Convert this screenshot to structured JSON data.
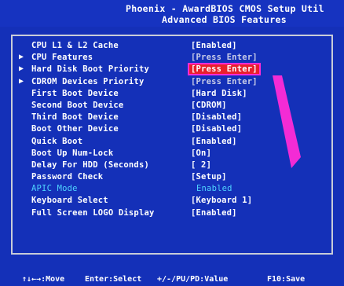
{
  "header": {
    "line1": "Phoenix - AwardBIOS CMOS Setup Util",
    "line2": "Advanced BIOS Features"
  },
  "rows": [
    {
      "arrow": "",
      "label": "CPU L1 & L2 Cache",
      "value": "[Enabled]"
    },
    {
      "arrow": "▶",
      "label": "CPU Features",
      "value": "[Press Enter]"
    },
    {
      "arrow": "▶",
      "label": "Hard Disk Boot Priority",
      "value": "[Press Enter]"
    },
    {
      "arrow": "▶",
      "label": "CDROM Devices Priority",
      "value": "[Press Enter]"
    },
    {
      "arrow": "",
      "label": "First Boot Device",
      "value": "[Hard Disk]"
    },
    {
      "arrow": "",
      "label": "Second Boot Device",
      "value": "[CDROM]"
    },
    {
      "arrow": "",
      "label": "Third Boot Device",
      "value": "[Disabled]"
    },
    {
      "arrow": "",
      "label": "Boot Other Device",
      "value": "[Disabled]"
    },
    {
      "arrow": "",
      "label": "Quick Boot",
      "value": "[Enabled]"
    },
    {
      "arrow": "",
      "label": "Boot Up Num-Lock",
      "value": "[On]"
    },
    {
      "arrow": "",
      "label": "Delay For HDD (Seconds)",
      "value": "[ 2]"
    },
    {
      "arrow": "",
      "label": "Password Check",
      "value": "[Setup]"
    },
    {
      "arrow": "",
      "label": "APIC Mode",
      "value": "Enabled"
    },
    {
      "arrow": "",
      "label": "Keyboard Select",
      "value": "[Keyboard 1]"
    },
    {
      "arrow": "",
      "label": "Full Screen LOGO Display",
      "value": "[Enabled]"
    }
  ],
  "footer": {
    "nav": "↑↓←→:Move",
    "enter": "Enter:Select",
    "value": "+/-/PU/PD:Value",
    "save": "F10:Save"
  },
  "colors": {
    "background": "#1430b8",
    "text": "#ffffff",
    "dim_text": "#4fd4ff",
    "selection": "#e8202c",
    "annotation": "#ff2bd6"
  }
}
